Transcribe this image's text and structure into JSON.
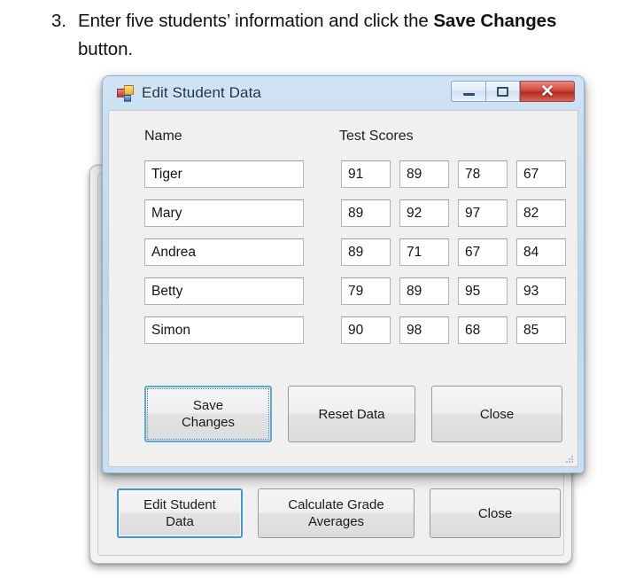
{
  "instruction": {
    "number": "3.",
    "text_before_bold": "Enter five students’ information and click the ",
    "bold_text": "Save Changes",
    "text_after_bold": " button."
  },
  "dialog": {
    "title": "Edit Student Data",
    "icon": "windows-forms-icon",
    "window_controls": {
      "minimize": "–",
      "maximize": "□",
      "close": "✕"
    },
    "headers": {
      "name": "Name",
      "test_scores": "Test Scores"
    },
    "rows": [
      {
        "name": "Tiger",
        "scores": [
          "91",
          "89",
          "78",
          "67"
        ]
      },
      {
        "name": "Mary",
        "scores": [
          "89",
          "92",
          "97",
          "82"
        ]
      },
      {
        "name": "Andrea",
        "scores": [
          "89",
          "71",
          "67",
          "84"
        ]
      },
      {
        "name": "Betty",
        "scores": [
          "79",
          "89",
          "95",
          "93"
        ]
      },
      {
        "name": "Simon",
        "scores": [
          "90",
          "98",
          "68",
          "85"
        ]
      }
    ],
    "buttons": {
      "save": "Save\nChanges",
      "reset": "Reset Data",
      "close": "Close"
    }
  },
  "background_window": {
    "buttons": {
      "edit": "Edit Student\nData",
      "calculate": "Calculate Grade\nAverages",
      "close": "Close"
    }
  },
  "colors": {
    "focus_border": "#3c99d4",
    "titlebar_blue": "#c5dcf0",
    "close_button_red": "#c43a2a",
    "panel_gray": "#f0f0f0"
  }
}
